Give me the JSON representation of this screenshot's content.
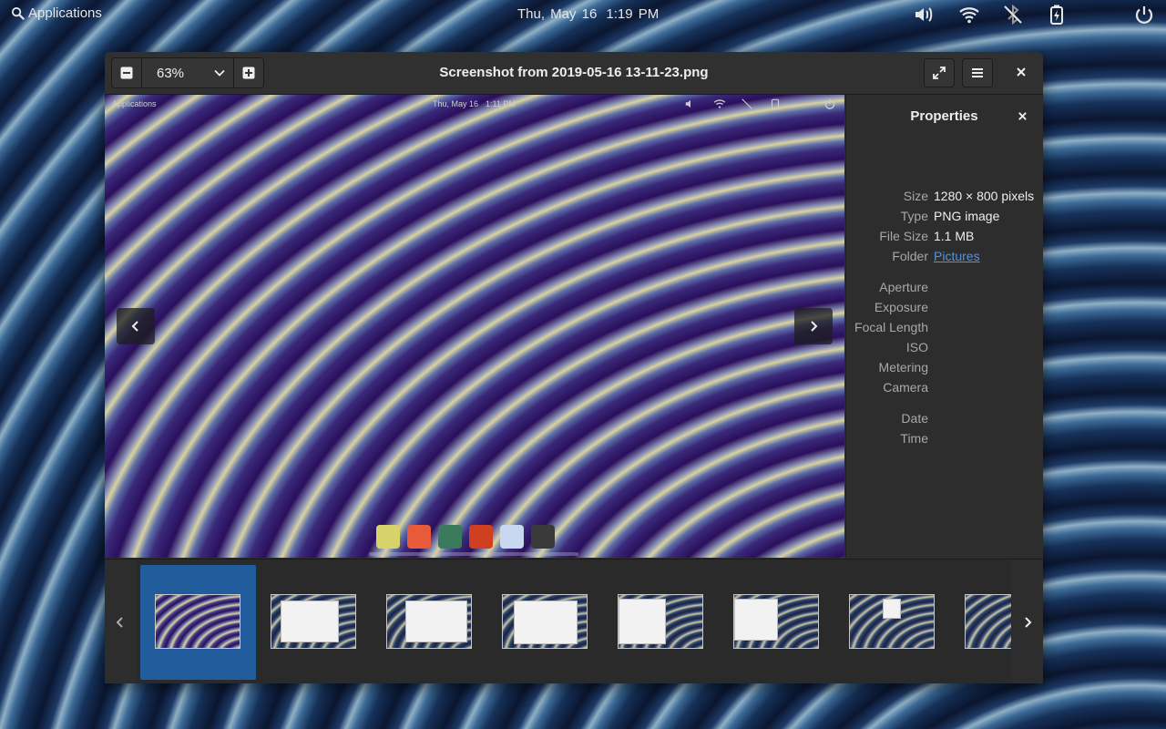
{
  "topbar": {
    "applications_label": "Applications",
    "date": "Thu, May 16",
    "time": "1:19 PM",
    "icons": [
      "search-icon",
      "volume-icon",
      "wifi-icon",
      "bluetooth-disabled-icon",
      "battery-charging-icon",
      "power-icon"
    ]
  },
  "window": {
    "title": "Screenshot from 2019-05-16 13-11-23.png",
    "zoom": {
      "value": "63%",
      "decrease_icon": "minus-icon",
      "increase_icon": "plus-icon",
      "dropdown_icon": "chevron-down-icon"
    },
    "header_buttons": [
      "fullscreen-icon",
      "hamburger-menu-icon",
      "close-icon"
    ]
  },
  "image_preview": {
    "topbar": {
      "applications_label": "Applications",
      "date": "Thu, May 16",
      "time": "1:11 PM"
    },
    "dock_colors": [
      "#d8d26a",
      "#e85a3a",
      "#3a7a5a",
      "#d04020",
      "#c8d8f0",
      "#3a3a3a"
    ]
  },
  "properties": {
    "title": "Properties",
    "rows": [
      {
        "label": "Size",
        "value": "1280 × 800 pixels"
      },
      {
        "label": "Type",
        "value": "PNG image"
      },
      {
        "label": "File Size",
        "value": "1.1 MB"
      },
      {
        "label": "Folder",
        "value": "Pictures"
      },
      {
        "label": "Aperture",
        "value": ""
      },
      {
        "label": "Exposure",
        "value": ""
      },
      {
        "label": "Focal Length",
        "value": ""
      },
      {
        "label": "ISO",
        "value": ""
      },
      {
        "label": "Metering",
        "value": ""
      },
      {
        "label": "Camera",
        "value": ""
      },
      {
        "label": "Date",
        "value": ""
      },
      {
        "label": "Time",
        "value": ""
      }
    ]
  },
  "thumbnails": {
    "count_visible": 8,
    "selected_index": 0
  },
  "colors": {
    "selection": "#215d9c",
    "link": "#5294e2",
    "headerbar": "#303030"
  }
}
